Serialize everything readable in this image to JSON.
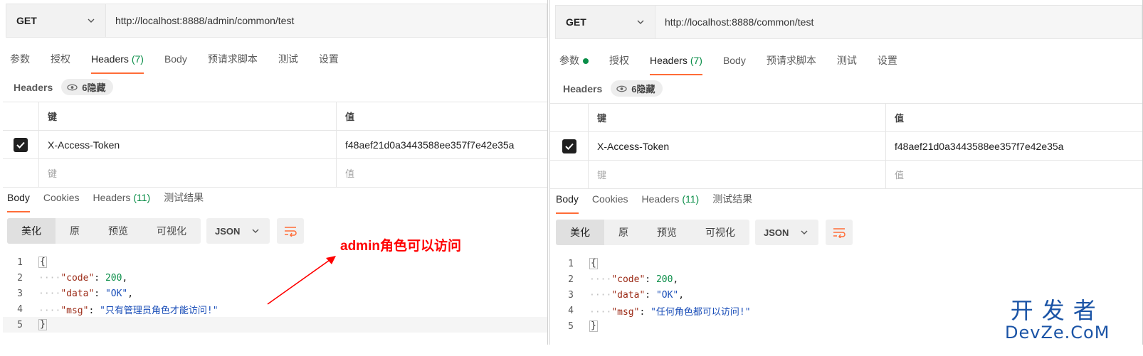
{
  "left": {
    "method": "GET",
    "url": "http://localhost:8888/admin/common/test",
    "request_tabs": [
      "参数",
      "授权",
      "Headers",
      "Body",
      "预请求脚本",
      "测试",
      "设置"
    ],
    "headers_count": "(7)",
    "headers_title": "Headers",
    "hidden_label": "6隐藏",
    "table": {
      "key_header": "键",
      "value_header": "值",
      "row_key": "X-Access-Token",
      "row_value": "f48aef21d0a3443588ee357f7e42e35a",
      "key_placeholder": "键",
      "value_placeholder": "值"
    },
    "response_tabs": [
      "Body",
      "Cookies",
      "Headers",
      "测试结果"
    ],
    "response_headers_count": "(11)",
    "view_modes": [
      "美化",
      "原",
      "预览",
      "可视化"
    ],
    "format": "JSON",
    "code": {
      "line_numbers": [
        "1",
        "2",
        "3",
        "4",
        "5"
      ],
      "open": "{",
      "close": "}",
      "code_key": "\"code\"",
      "code_val": "200",
      "data_key": "\"data\"",
      "data_val": "\"OK\"",
      "msg_key": "\"msg\"",
      "msg_val": "\"只有管理员角色才能访问!\""
    }
  },
  "right": {
    "method": "GET",
    "url": "http://localhost:8888/common/test",
    "request_tabs": [
      "参数",
      "授权",
      "Headers",
      "Body",
      "预请求脚本",
      "测试",
      "设置"
    ],
    "headers_count": "(7)",
    "headers_title": "Headers",
    "hidden_label": "6隐藏",
    "table": {
      "key_header": "键",
      "value_header": "值",
      "row_key": "X-Access-Token",
      "row_value": "f48aef21d0a3443588ee357f7e42e35a",
      "key_placeholder": "键",
      "value_placeholder": "值"
    },
    "response_tabs": [
      "Body",
      "Cookies",
      "Headers",
      "测试结果"
    ],
    "response_headers_count": "(11)",
    "view_modes": [
      "美化",
      "原",
      "预览",
      "可视化"
    ],
    "format": "JSON",
    "code": {
      "line_numbers": [
        "1",
        "2",
        "3",
        "4",
        "5"
      ],
      "open": "{",
      "close": "}",
      "code_key": "\"code\"",
      "code_val": "200",
      "data_key": "\"data\"",
      "data_val": "\"OK\"",
      "msg_key": "\"msg\"",
      "msg_val": "\"任何角色都可以访问!\""
    }
  },
  "annotation": "admin角色可以访问",
  "watermark": {
    "chinese": "开发者",
    "english": "DevZe.CoM"
  },
  "colors": {
    "accent": "#ff6c37",
    "green": "#0a8e48",
    "annotation": "#ff0000",
    "watermark": "#1b54a6"
  }
}
